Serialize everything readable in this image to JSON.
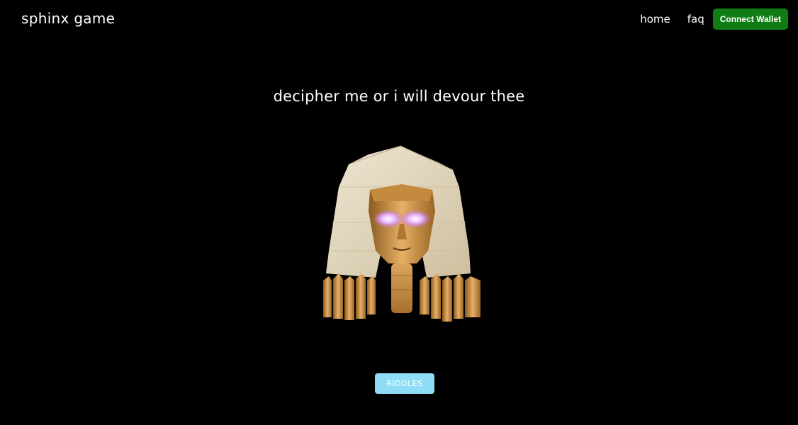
{
  "header": {
    "brand": "sphinx game",
    "nav": [
      {
        "label": "home"
      },
      {
        "label": "faq"
      }
    ],
    "wallet_label": "Connect Wallet",
    "wallet_color": "#0f7d14"
  },
  "main": {
    "headline": "decipher me or i will devour thee",
    "image_icon": "sphinx-head-icon",
    "riddles_label": "RIDDLES",
    "riddles_color": "#8fdcf6"
  }
}
